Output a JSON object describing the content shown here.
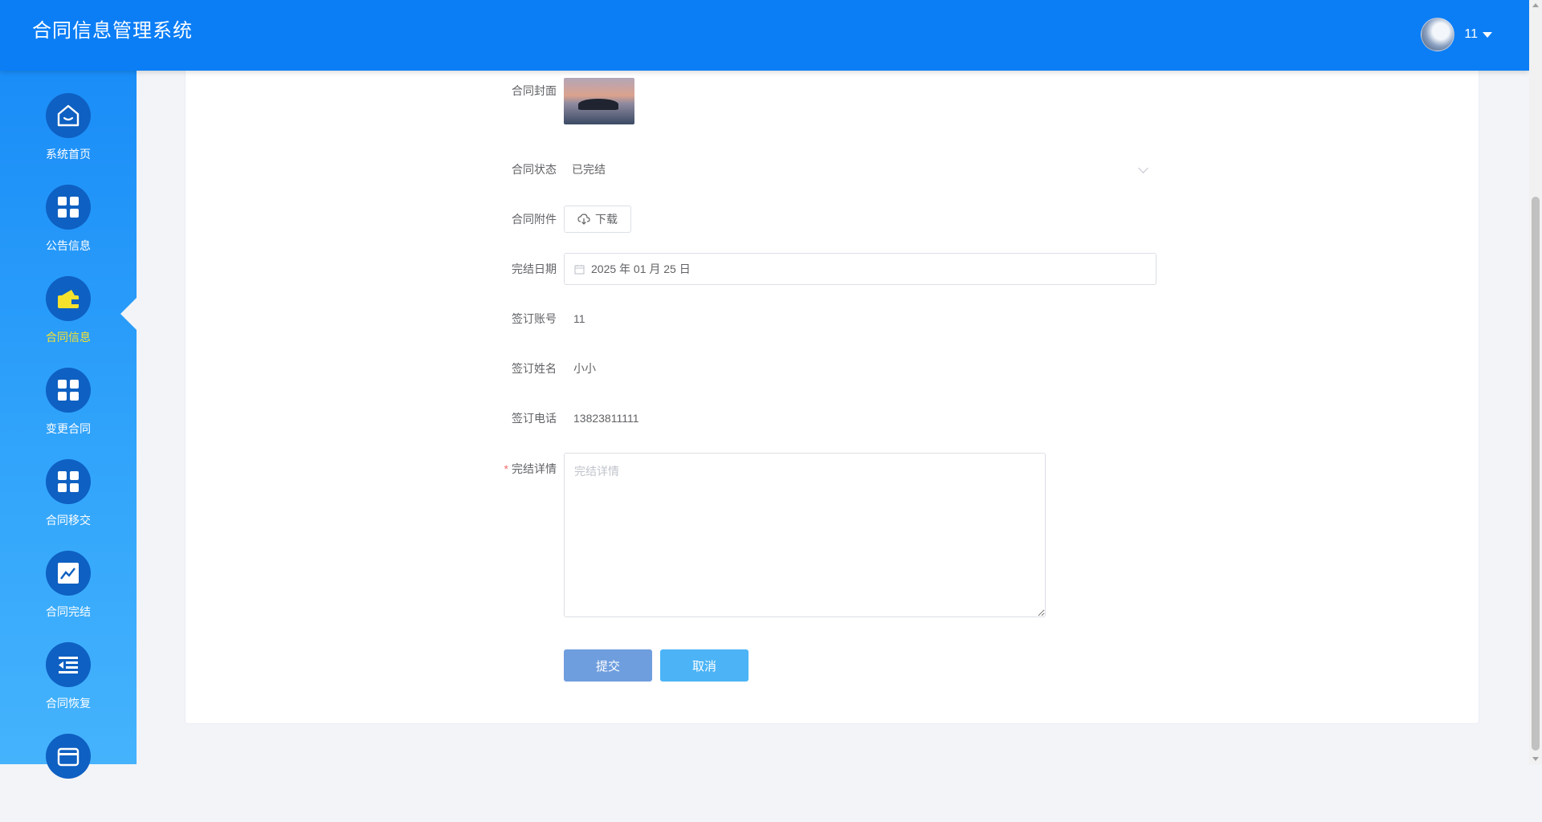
{
  "header": {
    "title": "合同信息管理系统",
    "user_name": "11"
  },
  "sidebar": {
    "items": [
      {
        "label": "系统首页",
        "icon": "home-icon"
      },
      {
        "label": "公告信息",
        "icon": "grid-icon"
      },
      {
        "label": "合同信息",
        "icon": "wallet-icon",
        "active": true
      },
      {
        "label": "变更合同",
        "icon": "grid-icon"
      },
      {
        "label": "合同移交",
        "icon": "grid-icon"
      },
      {
        "label": "合同完结",
        "icon": "chart-icon"
      },
      {
        "label": "合同恢复",
        "icon": "list-icon"
      },
      {
        "label": "",
        "icon": "card-icon"
      }
    ]
  },
  "form": {
    "cover_label": "合同封面",
    "status_label": "合同状态",
    "status_value": "已完结",
    "attachment_label": "合同附件",
    "download_label": "下载",
    "date_label": "完结日期",
    "date_value": "2025 年 01 月 25 日",
    "account_label": "签订账号",
    "account_value": "11",
    "name_label": "签订姓名",
    "name_value": "小小",
    "phone_label": "签订电话",
    "phone_value": "13823811111",
    "detail_label": "完结详情",
    "detail_placeholder": "完结详情",
    "submit_label": "提交",
    "cancel_label": "取消"
  },
  "colors": {
    "header": "#0b7ef6",
    "sidebar": "#1a8df8",
    "active_label": "#f6e22c",
    "submit": "#6f9ede",
    "cancel": "#4cb4f6"
  }
}
